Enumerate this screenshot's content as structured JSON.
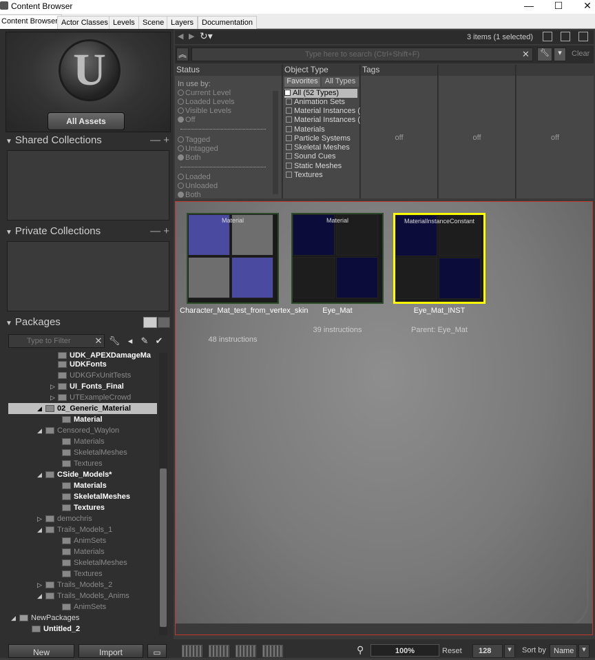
{
  "window": {
    "title": "Content Browser"
  },
  "tabs": [
    {
      "label": "Content Browser"
    },
    {
      "label": "Actor Classes"
    },
    {
      "label": "Levels"
    },
    {
      "label": "Scene"
    },
    {
      "label": "Layers"
    },
    {
      "label": "Documentation"
    }
  ],
  "left": {
    "all_assets": "All Assets",
    "shared_collections": "Shared Collections",
    "private_collections": "Private Collections",
    "packages": "Packages",
    "filter_placeholder": "Type to Filter",
    "tree": [
      {
        "label": "UDK_APEXDamageMa"
      },
      {
        "label": "UDKFonts"
      },
      {
        "label": "UDKGFxUnitTests"
      },
      {
        "label": "UI_Fonts_Final"
      },
      {
        "label": "UTExampleCrowd"
      },
      {
        "label": "02_Generic_Material"
      },
      {
        "label": "Material"
      },
      {
        "label": "Censored_Waylon"
      },
      {
        "label": "Materials"
      },
      {
        "label": "SkeletalMeshes"
      },
      {
        "label": "Textures"
      },
      {
        "label": "CSide_Models*"
      },
      {
        "label": "Materials"
      },
      {
        "label": "SkeletalMeshes"
      },
      {
        "label": "Textures"
      },
      {
        "label": "demochris"
      },
      {
        "label": "Trails_Models_1"
      },
      {
        "label": "AnimSets"
      },
      {
        "label": "Materials"
      },
      {
        "label": "SkeletalMeshes"
      },
      {
        "label": "Textures"
      },
      {
        "label": "Trails_Models_2"
      },
      {
        "label": "Trails_Models_Anims"
      },
      {
        "label": "AnimSets"
      },
      {
        "label": "NewPackages"
      },
      {
        "label": "Untitled_2"
      }
    ],
    "new_button": "New",
    "import_button": "Import"
  },
  "toolbar": {
    "items_count": "3 items (1 selected)",
    "search_placeholder": "Type here to search  (Ctrl+Shift+F)",
    "clear": "Clear"
  },
  "filters": {
    "status_header": "Status",
    "in_use_by": "In use by:",
    "status_options": [
      "Current Level",
      "Loaded Levels",
      "Visible Levels",
      "Off",
      "Tagged",
      "Untagged",
      "Both",
      "Loaded",
      "Unloaded",
      "Both"
    ],
    "object_type_header": "Object Type",
    "favorites_tab": "Favorites",
    "all_types_tab": "All Types",
    "types": [
      "All (52 Types)",
      "Animation Sets",
      "Material Instances (",
      "Material Instances (",
      "Materials",
      "Particle Systems",
      "Skeletal Meshes",
      "Sound Cues",
      "Static Meshes",
      "Textures"
    ],
    "tags_header": "Tags",
    "off_labels": [
      "off",
      "off",
      "off"
    ]
  },
  "assets": [
    {
      "type": "Material",
      "name": "Character_Mat_test_from_vertex_skin",
      "info": "48 instructions"
    },
    {
      "type": "Material",
      "name": "Eye_Mat",
      "info": "39 instructions"
    },
    {
      "type": "MaterialInstanceConstant",
      "name": "Eye_Mat_INST",
      "info": "Parent: Eye_Mat"
    }
  ],
  "statusbar": {
    "zoom": "100%",
    "reset": "Reset",
    "thumb_size": "128",
    "sort_by": "Sort by",
    "sort_value": "Name"
  },
  "colors": {
    "selection": "#ffff00",
    "accent_border": "#c0392b"
  }
}
